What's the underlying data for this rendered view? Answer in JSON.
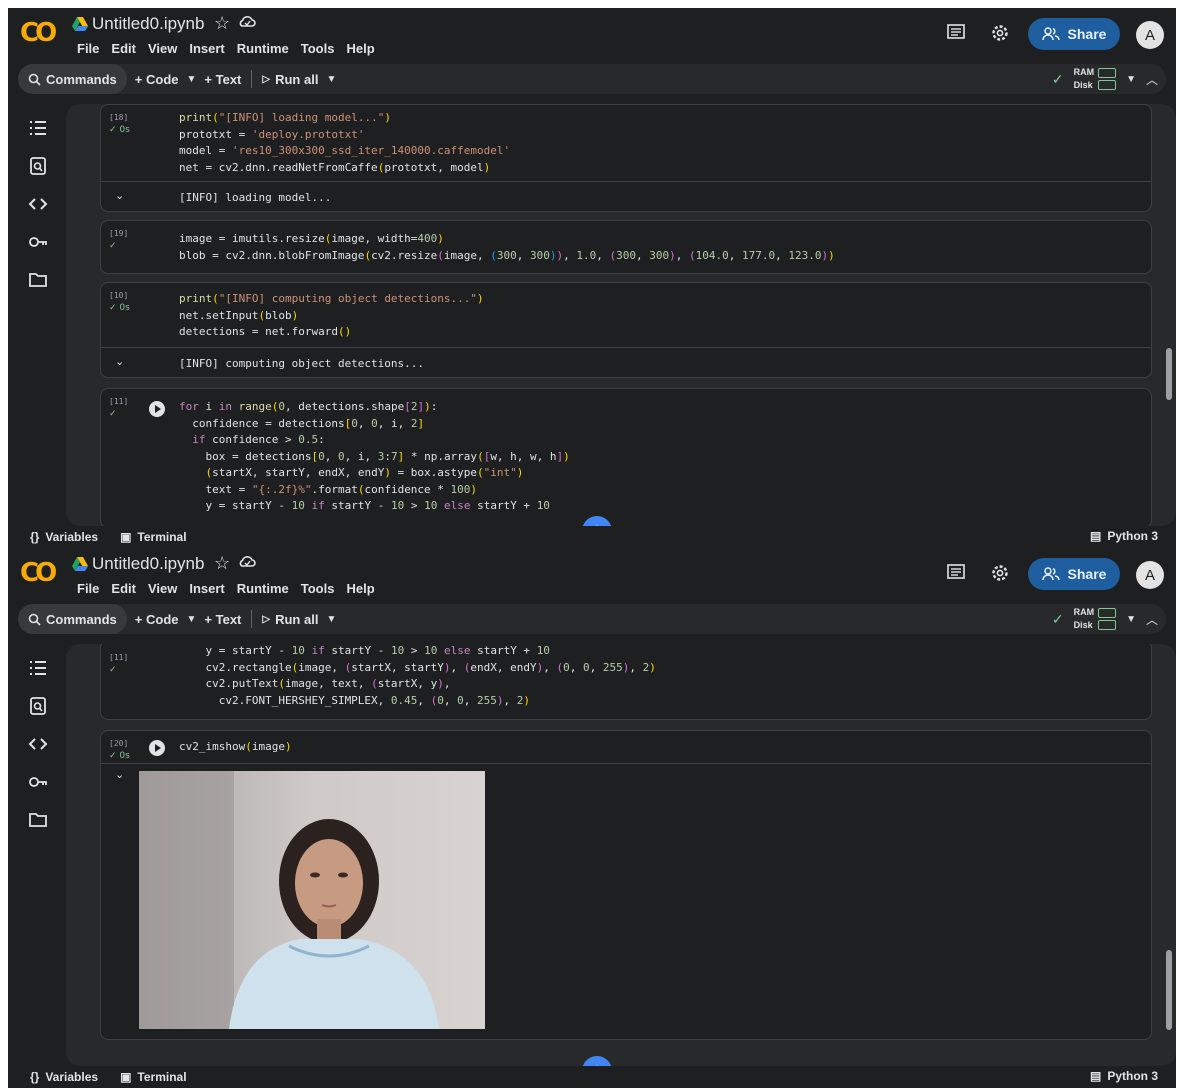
{
  "app": {
    "notebook_title": "Untitled0.ipynb",
    "menu": [
      "File",
      "Edit",
      "View",
      "Insert",
      "Runtime",
      "Tools",
      "Help"
    ],
    "share_label": "Share",
    "avatar_initial": "A"
  },
  "toolbar": {
    "commands_label": "Commands",
    "code_label": "+ Code",
    "text_label": "+ Text",
    "run_all_label": "Run all",
    "ram_label": "RAM",
    "disk_label": "Disk"
  },
  "status": {
    "variables_label": "Variables",
    "terminal_label": "Terminal",
    "runtime_label": "Python 3"
  },
  "top": {
    "cells": [
      {
        "exec": "[18]",
        "time": "0s",
        "output": "[INFO] loading model..."
      },
      {
        "exec": "[19]",
        "time": ""
      },
      {
        "exec": "[10]",
        "time": "0s",
        "output": "[INFO] computing object detections..."
      },
      {
        "exec": "[11]",
        "time": ""
      }
    ]
  },
  "bottom": {
    "cells": [
      {
        "exec": "[11]",
        "time": ""
      },
      {
        "exec": "[20]",
        "time": "0s",
        "output_more": "..."
      }
    ]
  },
  "colors": {
    "background": "#1e1f20",
    "share": "#1f5e9e",
    "success": "#81c995",
    "gemini": "#4285f4"
  }
}
